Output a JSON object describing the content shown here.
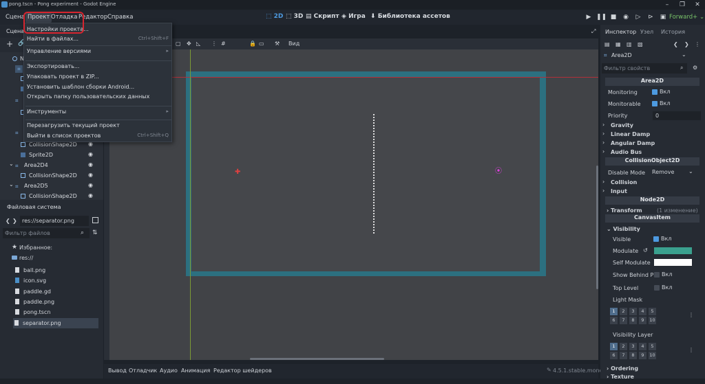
{
  "window": {
    "title": "pong.tscn - Pong experiment - Godot Engine"
  },
  "menu": {
    "items": [
      "Сцена",
      "Проект",
      "Отладка",
      "Редактор",
      "Справка"
    ]
  },
  "workspaces": [
    "2D",
    "3D",
    "Скрипт",
    "Игра",
    "Библиотека ассетов"
  ],
  "renderer": "Forward+",
  "project_menu": {
    "items": [
      {
        "label": "Настройки проекта...",
        "shortcut": ""
      },
      {
        "label": "Найти в файлах...",
        "shortcut": "Ctrl+Shift+F"
      },
      {
        "label": "Управление версиями",
        "shortcut": ""
      },
      {
        "label": "Экспортировать...",
        "shortcut": ""
      },
      {
        "label": "Упаковать проект в ZIP...",
        "shortcut": ""
      },
      {
        "label": "Установить шаблон сборки Android...",
        "shortcut": ""
      },
      {
        "label": "Открыть папку пользовательских данных",
        "shortcut": ""
      },
      {
        "label": "Инструменты",
        "shortcut": ""
      },
      {
        "label": "Перезагрузить текущий проект",
        "shortcut": ""
      },
      {
        "label": "Выйти в список проектов",
        "shortcut": "Ctrl+Shift+Q"
      }
    ]
  },
  "scene_dock": {
    "tab": "Сцена",
    "root_prefix": "N"
  },
  "scene_tree": [
    {
      "label": "CollisionShape2D",
      "indent": 2,
      "icon": "collision"
    },
    {
      "label": "Sprite2D",
      "indent": 2,
      "icon": "sprite"
    },
    {
      "label": "Area2D4",
      "indent": 1,
      "icon": "area"
    },
    {
      "label": "CollisionShape2D",
      "indent": 2,
      "icon": "collision"
    },
    {
      "label": "Area2D5",
      "indent": 1,
      "icon": "area"
    },
    {
      "label": "CollisionShape2D",
      "indent": 2,
      "icon": "collision"
    }
  ],
  "filesystem": {
    "title": "Файловая система",
    "path": "res://separator.png",
    "filter_placeholder": "Фильтр файлов",
    "favorites": "Избранное:",
    "root": "res://",
    "files": [
      "ball.png",
      "icon.svg",
      "paddle.gd",
      "paddle.png",
      "pong.tscn",
      "separator.png"
    ]
  },
  "viewport": {
    "view_label": "Вид"
  },
  "bottom_tabs": [
    "Вывод",
    "Отладчик",
    "Аудио",
    "Анимация",
    "Редактор шейдеров"
  ],
  "version": "4.5.1.stable.mono",
  "inspector": {
    "tabs": [
      "Инспектор",
      "Узел",
      "История"
    ],
    "node": "Area2D",
    "filter_placeholder": "Фильтр свойств",
    "section_area": "Area2D",
    "monitoring_label": "Monitoring",
    "monitoring_value": "Вкл",
    "monitorable_label": "Monitorable",
    "monitorable_value": "Вкл",
    "priority_label": "Priority",
    "priority_value": "0",
    "groups1": [
      "Gravity",
      "Linear Damp",
      "Angular Damp",
      "Audio Bus"
    ],
    "section_collision": "CollisionObject2D",
    "disable_mode_label": "Disable Mode",
    "disable_mode_value": "Remove",
    "groups2": [
      "Collision",
      "Input"
    ],
    "section_node2d": "Node2D",
    "transform_label": "Transform",
    "transform_note": "(1 изменение)",
    "section_canvas": "CanvasItem",
    "visibility_label": "Visibility",
    "visible_label": "Visible",
    "visible_value": "Вкл",
    "modulate_label": "Modulate",
    "modulate_color": "#3aa08e",
    "self_modulate_label": "Self Modulate",
    "self_modulate_color": "#ffffff",
    "show_behind_label": "Show Behind P",
    "show_behind_value": "Вкл",
    "top_level_label": "Top Level",
    "top_level_value": "Вкл",
    "light_mask_label": "Light Mask",
    "visibility_layer_label": "Visibility Layer",
    "ordering_label": "Ordering",
    "texture_label": "Texture",
    "mask_cells": [
      "1",
      "2",
      "3",
      "4",
      "5",
      "6",
      "7",
      "8",
      "9",
      "10"
    ]
  },
  "colors": {
    "accent": "#4d9ae0",
    "highlight": "#d8252f",
    "teal": "#2d7a8a"
  }
}
